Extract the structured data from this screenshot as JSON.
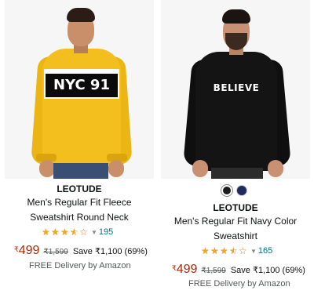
{
  "products": [
    {
      "image_print": "NYC 91",
      "brand": "LEOTUDE",
      "title_lines": [
        "Men's Regular Fit Fleece",
        "Sweatshirt Round Neck"
      ],
      "rating": 3.5,
      "rating_count": "195",
      "currency_symbol": "₹",
      "price": "499",
      "mrp": "₹1,599",
      "save_text": "Save ₹1,100 (69%)",
      "delivery": "FREE Delivery by Amazon",
      "shirt_color": "#f3bf1f"
    },
    {
      "image_print": "BELIEVE",
      "brand": "LEOTUDE",
      "title_lines": [
        "Men's Regular Fit Navy Color",
        "Sweatshirt"
      ],
      "rating": 3.5,
      "rating_count": "165",
      "currency_symbol": "₹",
      "price": "499",
      "mrp": "₹1,599",
      "save_text": "Save ₹1,100 (69%)",
      "delivery": "FREE Delivery by Amazon",
      "shirt_color": "#141414",
      "swatches": [
        {
          "name": "black",
          "color": "#1b1b1b",
          "selected": true
        },
        {
          "name": "navy",
          "color": "#1f2a5e",
          "selected": false
        }
      ]
    }
  ],
  "icons": {
    "star": "star-icon",
    "chevron": "chevron-down-icon"
  },
  "colors": {
    "price": "#b12704",
    "link": "#007185",
    "star": "#f4a41c"
  }
}
